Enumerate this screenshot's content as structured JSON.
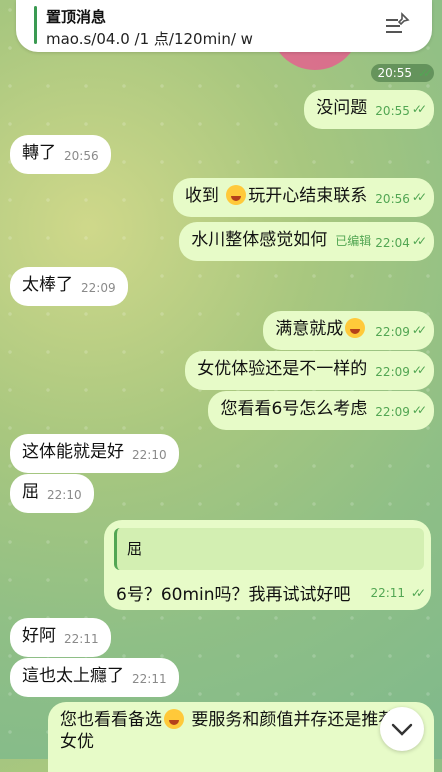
{
  "pinned": {
    "title": "置顶消息",
    "subtitle": "mao.s/04.0 /1 点/120min/ w"
  },
  "date_stamp": "20:55",
  "messages": [
    {
      "side": "out",
      "text": "没问题",
      "time": "20:55"
    },
    {
      "side": "in",
      "text": "轉了",
      "time": "20:56"
    },
    {
      "side": "out",
      "text": "收到 ",
      "text2": "玩开心结束联系",
      "time": "20:56"
    },
    {
      "side": "out",
      "text": "水川整体感觉如何",
      "time": "22:04",
      "edited": "已编辑"
    },
    {
      "side": "in",
      "text": "太棒了",
      "time": "22:09"
    },
    {
      "side": "out",
      "text": "满意就成",
      "time": "22:09"
    },
    {
      "side": "out",
      "text": "女优体验还是不一样的",
      "time": "22:09"
    },
    {
      "side": "out",
      "text": "您看看6号怎么考虑",
      "time": "22:09"
    },
    {
      "side": "in",
      "text": "这体能就是好",
      "time": "22:10"
    },
    {
      "side": "in",
      "text": "屈",
      "time": "22:10"
    },
    {
      "side": "in",
      "text": "好阿",
      "time": "22:11"
    },
    {
      "side": "in",
      "text": "這也太上癮了",
      "time": "22:11"
    }
  ],
  "reply": {
    "quote": "屈",
    "text": "6号？60min吗？我再试试好吧",
    "time": "22:11"
  },
  "last": {
    "line1a": "您也看看备选",
    "line1b": " 要服务和颜值并存还是推荐",
    "line2": "女优"
  }
}
